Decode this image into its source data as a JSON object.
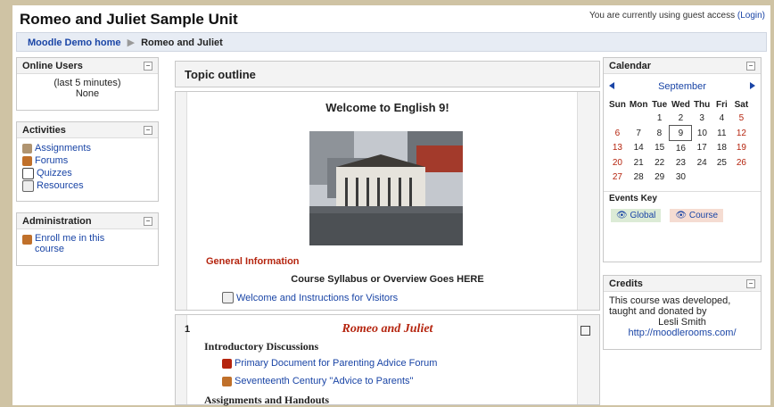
{
  "page": {
    "title": "Romeo and Juliet Sample Unit",
    "guest_text": "You are currently using guest access",
    "login_label": "(Login)"
  },
  "breadcrumb": {
    "home": "Moodle Demo home",
    "separator": "▶",
    "current": "Romeo and Juliet"
  },
  "online_users": {
    "title": "Online Users",
    "period": "(last 5 minutes)",
    "value": "None"
  },
  "activities": {
    "title": "Activities",
    "items": [
      {
        "label": "Assignments",
        "icon": "assignment-icon"
      },
      {
        "label": "Forums",
        "icon": "forum-icon"
      },
      {
        "label": "Quizzes",
        "icon": "quiz-icon"
      },
      {
        "label": "Resources",
        "icon": "resource-icon"
      }
    ]
  },
  "administration": {
    "title": "Administration",
    "enroll_label": "Enroll me in this course"
  },
  "topic_outline": {
    "title": "Topic outline"
  },
  "section0": {
    "heading": "Welcome to English 9!",
    "general_info": "General Information",
    "syllabus": "Course Syllabus or Overview Goes HERE",
    "welcome_link": "Welcome and Instructions for Visitors"
  },
  "section1": {
    "number": "1",
    "title": "Romeo and Juliet",
    "intro_heading": "Introductory Discussions",
    "links": [
      "Primary Document for Parenting Advice Forum",
      "Seventeenth Century \"Advice to Parents\""
    ],
    "assign_heading": "Assignments and Handouts"
  },
  "calendar": {
    "title": "Calendar",
    "month": "September",
    "days": [
      "Sun",
      "Mon",
      "Tue",
      "Wed",
      "Thu",
      "Fri",
      "Sat"
    ],
    "weeks": [
      [
        "",
        "",
        "1",
        "2",
        "3",
        "4",
        "5"
      ],
      [
        "6",
        "7",
        "8",
        "9",
        "10",
        "11",
        "12"
      ],
      [
        "13",
        "14",
        "15",
        "16",
        "17",
        "18",
        "19"
      ],
      [
        "20",
        "21",
        "22",
        "23",
        "24",
        "25",
        "26"
      ],
      [
        "27",
        "28",
        "29",
        "30",
        "",
        "",
        ""
      ]
    ],
    "today": "9",
    "events_key": "Events Key",
    "global_label": "Global",
    "course_label": "Course",
    "weekend_color": "#b5250f"
  },
  "credits": {
    "title": "Credits",
    "text": "This course was developed, taught and donated by",
    "author": "Lesli Smith",
    "url": "http://moodlerooms.com/"
  },
  "colors": {
    "link": "#1a45a6",
    "accent_red": "#b5250f",
    "nav_bg": "#e7ecf4",
    "border_bg": "#cfc3a4"
  }
}
